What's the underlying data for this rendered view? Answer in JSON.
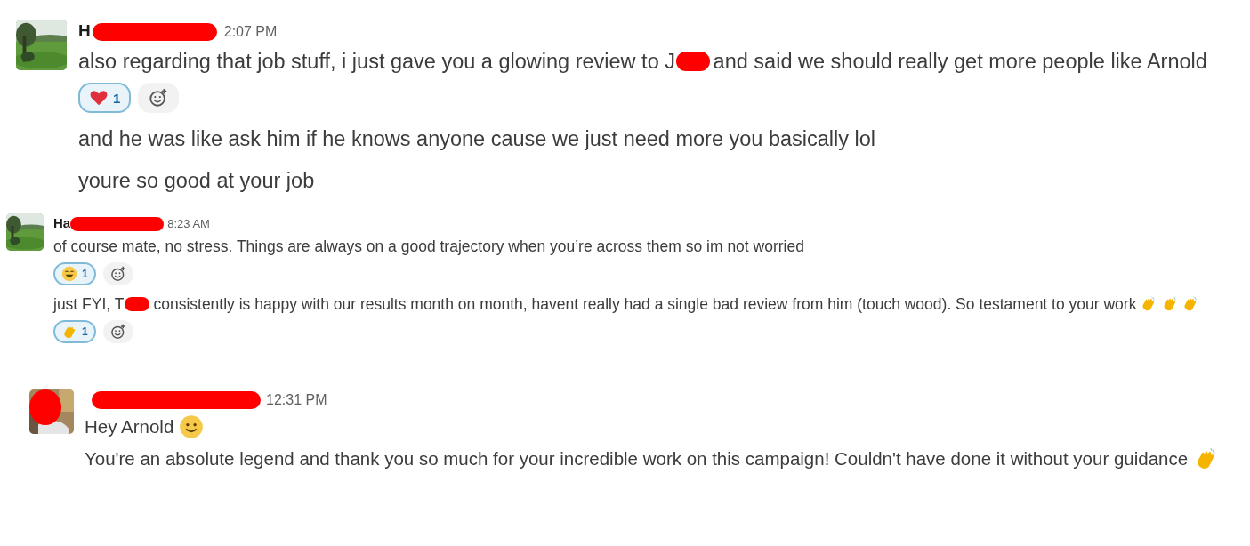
{
  "blocks": [
    {
      "sender": "H",
      "time": "2:07 PM",
      "avatar": {
        "kind": "picture"
      },
      "messages": [
        {
          "parts": [
            {
              "kind": "text",
              "text": "also regarding that job stuff, i just gave you a glowing review to J"
            },
            {
              "kind": "redaction"
            },
            {
              "kind": "text",
              "text": "and said we should really get more people like Arnold"
            }
          ],
          "reactions": [
            {
              "kind": "heart",
              "count": "1",
              "selected": true
            }
          ]
        },
        {
          "parts": [
            {
              "kind": "text",
              "text": "and he was like ask him if he knows anyone cause we just need more you basically lol"
            }
          ]
        },
        {
          "parts": [
            {
              "kind": "text",
              "text": "youre so good at your job"
            }
          ]
        }
      ]
    },
    {
      "sender": "Ha",
      "time": "8:23 AM",
      "avatar": {
        "kind": "picture"
      },
      "messages": [
        {
          "parts": [
            {
              "kind": "text",
              "text": "of course mate, no stress. Things are always on a good trajectory when you’re across them so im not worried"
            }
          ],
          "reactions": [
            {
              "kind": "grin",
              "count": "1",
              "selected": true
            }
          ]
        },
        {
          "parts": [
            {
              "kind": "text",
              "text": "just FYI, T"
            },
            {
              "kind": "redaction"
            },
            {
              "kind": "text",
              "text": "consistently is happy with our results month on month, havent really had a single bad review from him (touch wood). So testament to your work"
            },
            {
              "kind": "clap"
            },
            {
              "kind": "clap"
            },
            {
              "kind": "clap"
            }
          ],
          "reactions": [
            {
              "kind": "clap",
              "count": "1",
              "selected": true
            }
          ]
        }
      ]
    },
    {
      "time": "12:31 PM",
      "avatar": {
        "kind": "picture",
        "redacted": true
      },
      "messages": [
        {
          "parts": [
            {
              "kind": "text",
              "text": "Hey Arnold"
            },
            {
              "kind": "smile"
            }
          ]
        },
        {
          "parts": [
            {
              "kind": "text",
              "text": "You're an absolute legend and thank you so much for your incredible work on this campaign! Couldn't have done it without your guidance"
            },
            {
              "kind": "clap"
            }
          ]
        }
      ]
    }
  ]
}
